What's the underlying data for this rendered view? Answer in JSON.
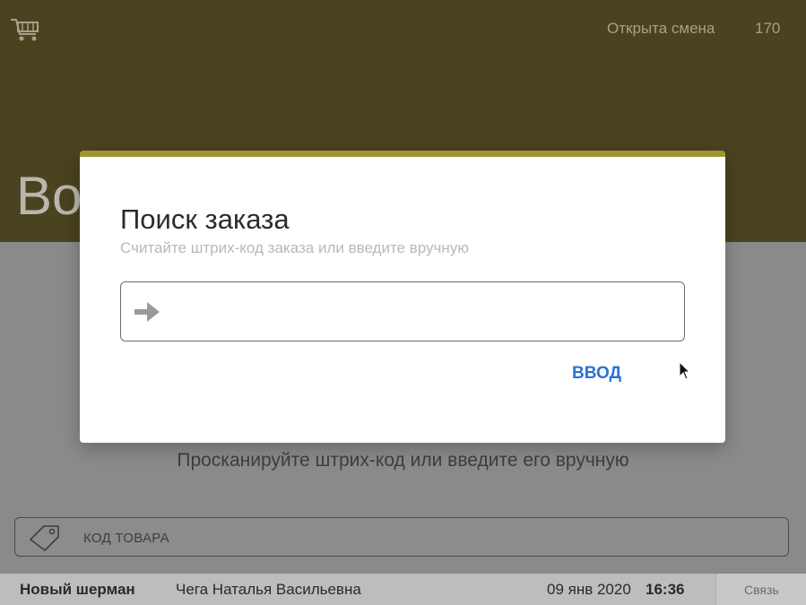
{
  "header": {
    "shift_status": "Открыта смена",
    "shift_number": "170",
    "title_partial": "Во",
    "cart_icon": "shopping-cart-icon"
  },
  "main": {
    "scan_hint": "Просканируйте штрих-код или введите его вручную",
    "product_code_placeholder": "КОД ТОВАРА",
    "tag_icon": "price-tag-icon"
  },
  "modal": {
    "title": "Поиск заказа",
    "subtitle": "Считайте штрих-код заказа или введите вручную",
    "input_value": "",
    "arrow_icon": "arrow-right-icon",
    "enter_label": "ВВОД",
    "accent_color": "#9e9532"
  },
  "status_bar": {
    "store_name": "Новый шерман",
    "cashier": "Чега Наталья Васильевна",
    "date": "09 янв 2020",
    "time": "16:36",
    "connection_label": "Связь"
  },
  "colors": {
    "header_bg": "#4a4320",
    "link_blue": "#2c73d2"
  }
}
